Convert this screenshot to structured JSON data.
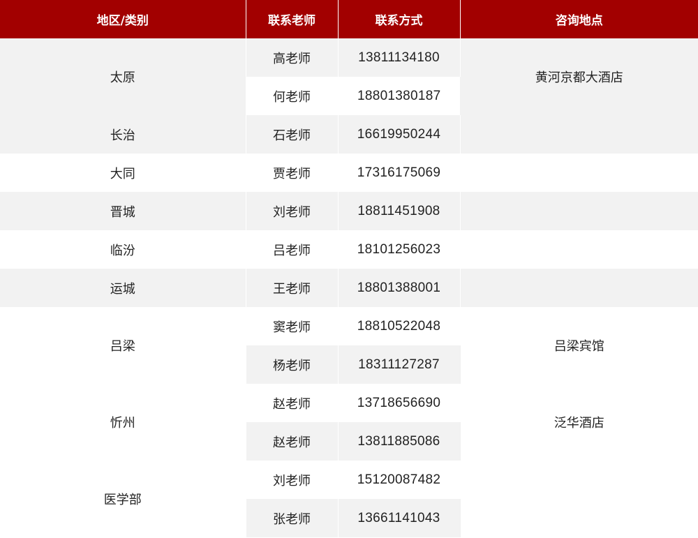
{
  "headers": {
    "region": "地区/类别",
    "teacher": "联系老师",
    "contact": "联系方式",
    "location": "咨询地点"
  },
  "rows": [
    {
      "region": "太原",
      "contacts": [
        {
          "teacher": "高老师",
          "phone": "13811134180"
        },
        {
          "teacher": "何老师",
          "phone": "18801380187"
        }
      ],
      "location": "黄河京都大酒店"
    },
    {
      "region": "长治",
      "contacts": [
        {
          "teacher": "石老师",
          "phone": "16619950244"
        }
      ],
      "location": ""
    },
    {
      "region": "大同",
      "contacts": [
        {
          "teacher": "贾老师",
          "phone": "17316175069"
        }
      ],
      "location": ""
    },
    {
      "region": "晋城",
      "contacts": [
        {
          "teacher": "刘老师",
          "phone": "18811451908"
        }
      ],
      "location": ""
    },
    {
      "region": "临汾",
      "contacts": [
        {
          "teacher": "吕老师",
          "phone": "18101256023"
        }
      ],
      "location": ""
    },
    {
      "region": "运城",
      "contacts": [
        {
          "teacher": "王老师",
          "phone": "18801388001"
        }
      ],
      "location": ""
    },
    {
      "region": "吕梁",
      "contacts": [
        {
          "teacher": "窦老师",
          "phone": "18810522048"
        },
        {
          "teacher": "杨老师",
          "phone": "18311127287"
        }
      ],
      "location": "吕梁宾馆"
    },
    {
      "region": "忻州",
      "contacts": [
        {
          "teacher": "赵老师",
          "phone": "13718656690"
        },
        {
          "teacher": "赵老师",
          "phone": "13811885086"
        }
      ],
      "location": "泛华酒店"
    },
    {
      "region": "医学部",
      "contacts": [
        {
          "teacher": "刘老师",
          "phone": "15120087482"
        },
        {
          "teacher": "张老师",
          "phone": "13661141043"
        }
      ],
      "location": ""
    }
  ],
  "colors": {
    "header_bg": "#a20000",
    "header_text": "#ffffff",
    "row_shade": "#f2f2f2",
    "row_plain": "#ffffff"
  }
}
